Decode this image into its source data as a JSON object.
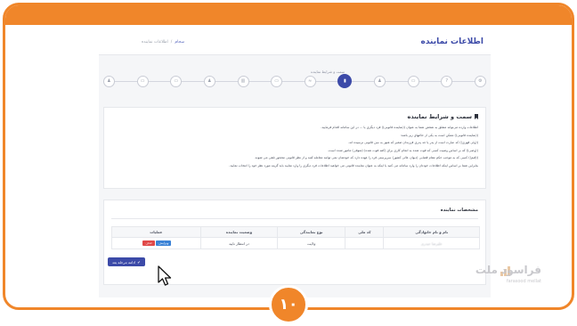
{
  "header": {
    "title": "اطلاعات نماینده",
    "breadcrumb": [
      "سجام",
      "اطلاعات نماینده"
    ]
  },
  "stepper": {
    "current_label": "سمت و شرایط نماینده",
    "steps": [
      {
        "icon": "gear-icon",
        "glyph": "⚙"
      },
      {
        "icon": "question-icon",
        "glyph": "?"
      },
      {
        "icon": "card-icon",
        "glyph": "▭"
      },
      {
        "icon": "user-icon",
        "glyph": "♟"
      },
      {
        "icon": "bookmark-icon",
        "glyph": "▮"
      },
      {
        "icon": "graduation-icon",
        "glyph": "≈"
      },
      {
        "icon": "card-icon",
        "glyph": "▭"
      },
      {
        "icon": "bank-icon",
        "glyph": "▥"
      },
      {
        "icon": "user-icon",
        "glyph": "♟"
      },
      {
        "icon": "id-icon",
        "glyph": "▭"
      },
      {
        "icon": "card-icon",
        "glyph": "▭"
      },
      {
        "icon": "user-icon",
        "glyph": "♟"
      }
    ],
    "current_index": 4
  },
  "terms": {
    "title": "سمت و شرایط نماینده",
    "lines": [
      "اطلاعات وارده می‌تواند متعلق به شخص شما به عنوان ((نماینده قانونی)) فرد دیگری یا ... در این سامانه اقدام فرمایید.",
      "((نماینده قانونی)) ممکن است به یکی از حالتهای زیر باشد:",
      "((ولی قهری)) که عبارت است از پدر یا جد پدری فرزندان صغیر که هنوز به سن قانونی نرسیده اند.",
      "((وصی)) که بر اساس وصیت کسی که فوت شده به انجام کاری برای (کفه فوت شده) (متوفی) مامور شده است.",
      "((قیم)) کسی که به موجب حکم مقام قضایی (دیوان عالی کشور) سرپرستی فرد را عهده دارد که خودشان نمی توانند معامله کنند و از نظر قانونی محجور تلقی می شوند.",
      "بنابراین شما بر اساس اینکه اطلاعات خودتان را وارد سامانه می کنید یا اینکه به عنوان نماینده قانونی می خواهید اطلاعات فرد دیگری را وارد نمایید باید گزینه مورد نظر خود را انتخاب نمایید."
    ]
  },
  "agents": {
    "title": "مشخصات نماینده",
    "columns": [
      "نام و نام خانوادگی",
      "کد ملی",
      "نوع نمایندگی",
      "وضعیت نماینده",
      "عملیات"
    ],
    "rows": [
      {
        "name": "علیرضا حیدری",
        "national_code": "",
        "type": "ولایت",
        "status": "در انتظار تایید",
        "edit_label": "ویرایش",
        "delete_label": "حذف"
      }
    ],
    "next_label": "ادامه مرحله بعد"
  },
  "watermark": {
    "brand": "فرا‌سود ملت",
    "sub": "farasood mellat"
  },
  "badge": {
    "number": "۱۰"
  },
  "colors": {
    "accent": "#f0862a",
    "primary": "#3c4aa8",
    "edit": "#3b82d6",
    "delete": "#e04848"
  }
}
